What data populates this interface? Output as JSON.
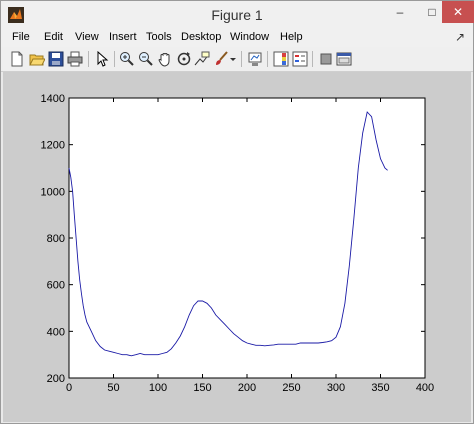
{
  "window": {
    "title": "Figure 1",
    "controls": {
      "minimize": "–",
      "maximize": "□",
      "close": "✕"
    }
  },
  "menu": {
    "items": [
      "File",
      "Edit",
      "View",
      "Insert",
      "Tools",
      "Desktop",
      "Window",
      "Help"
    ]
  },
  "toolbar": {
    "buttons": [
      "new-figure-icon",
      "open-file-icon",
      "save-icon",
      "print-icon",
      "edit-plot-arrow-icon",
      "zoom-in-icon",
      "zoom-out-icon",
      "pan-hand-icon",
      "rotate-3d-icon",
      "data-cursor-icon",
      "brush-icon",
      "brush-dropdown-icon",
      "link-plot-icon",
      "insert-colorbar-icon",
      "insert-legend-icon",
      "hide-plot-tools-icon",
      "show-plot-tools-icon"
    ]
  },
  "colors": {
    "line": "#1a1aa6",
    "axes_bg": "#ffffff",
    "figure_bg": "#cccccc",
    "close_button": "#c75050"
  },
  "chart_data": {
    "type": "line",
    "title": "",
    "xlabel": "",
    "ylabel": "",
    "xlim": [
      0,
      400
    ],
    "ylim": [
      200,
      1400
    ],
    "xticks": [
      0,
      50,
      100,
      150,
      200,
      250,
      300,
      350,
      400
    ],
    "yticks": [
      200,
      400,
      600,
      800,
      1000,
      1200,
      1400
    ],
    "grid": false,
    "series": [
      {
        "x": [
          0,
          2,
          4,
          6,
          8,
          10,
          12,
          14,
          16,
          18,
          20,
          25,
          30,
          35,
          40,
          45,
          50,
          55,
          60,
          65,
          70,
          75,
          80,
          85,
          90,
          95,
          100,
          105,
          110,
          115,
          120,
          125,
          130,
          135,
          140,
          145,
          150,
          155,
          160,
          165,
          170,
          175,
          180,
          185,
          190,
          195,
          200,
          205,
          210,
          215,
          220,
          225,
          230,
          235,
          240,
          245,
          250,
          255,
          260,
          265,
          270,
          275,
          280,
          285,
          290,
          295,
          300,
          305,
          310,
          315,
          320,
          325,
          330,
          335,
          340,
          345,
          350,
          355,
          358
        ],
        "y": [
          1100,
          1060,
          1000,
          900,
          800,
          700,
          620,
          560,
          510,
          470,
          440,
          400,
          360,
          335,
          320,
          315,
          310,
          305,
          300,
          300,
          295,
          300,
          305,
          300,
          300,
          300,
          300,
          305,
          310,
          325,
          350,
          380,
          420,
          470,
          510,
          530,
          530,
          520,
          500,
          470,
          450,
          430,
          410,
          390,
          375,
          360,
          350,
          345,
          340,
          340,
          338,
          340,
          342,
          345,
          345,
          345,
          345,
          345,
          350,
          350,
          350,
          350,
          350,
          352,
          355,
          360,
          375,
          420,
          520,
          680,
          880,
          1100,
          1250,
          1340,
          1320,
          1220,
          1140,
          1100,
          1090
        ]
      }
    ]
  }
}
